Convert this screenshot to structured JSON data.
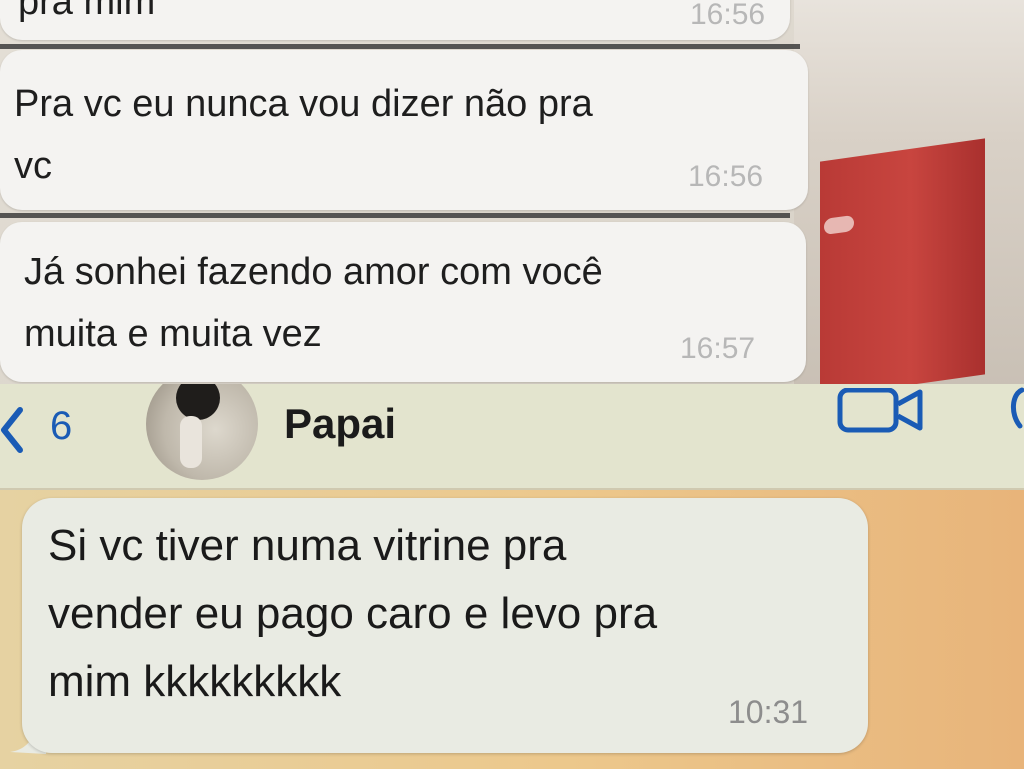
{
  "top_chat": {
    "partial_message": {
      "text": "pra mim",
      "time": "16:56"
    },
    "messages": [
      {
        "lines": [
          "Pra vc eu nunca vou dizer não pra",
          "vc"
        ],
        "time": "16:56"
      },
      {
        "lines": [
          "Já sonhei fazendo amor com você",
          "muita e muita vez"
        ],
        "time": "16:57"
      }
    ]
  },
  "bottom_chat": {
    "header": {
      "back_icon": "chevron-left-icon",
      "unread_count": "6",
      "contact_name": "Papai",
      "video_icon": "video-camera-icon",
      "call_icon": "phone-icon",
      "accent_color": "#1a5bb5"
    },
    "message": {
      "lines": [
        "Si vc tiver numa vitrine pra",
        "vender eu pago caro e levo pra",
        "mim kkkkkkkkk"
      ],
      "time": "10:31"
    }
  }
}
